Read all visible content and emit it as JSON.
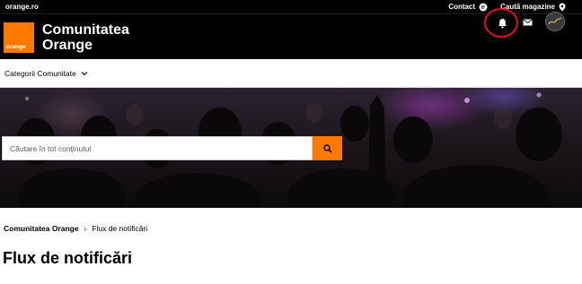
{
  "topbar": {
    "site_link": "orange.ro",
    "contact": "Contact",
    "stores": "Caută magazine"
  },
  "header": {
    "logo_text": "orange",
    "title_line1": "Comunitatea",
    "title_line2": "Orange",
    "icons": [
      "bell-icon",
      "mail-icon",
      "avatar"
    ]
  },
  "nav": {
    "categories": "Categorii Comunitate"
  },
  "search": {
    "placeholder": "Căutare în tot conținutul",
    "button_icon": "search-icon"
  },
  "breadcrumb": {
    "home": "Comunitatea Orange",
    "current": "Flux de notificări"
  },
  "page": {
    "title": "Flux de notificări"
  },
  "colors": {
    "brand": "#ff7900",
    "highlight_ring": "#e3101f",
    "header_bg": "#000000"
  }
}
